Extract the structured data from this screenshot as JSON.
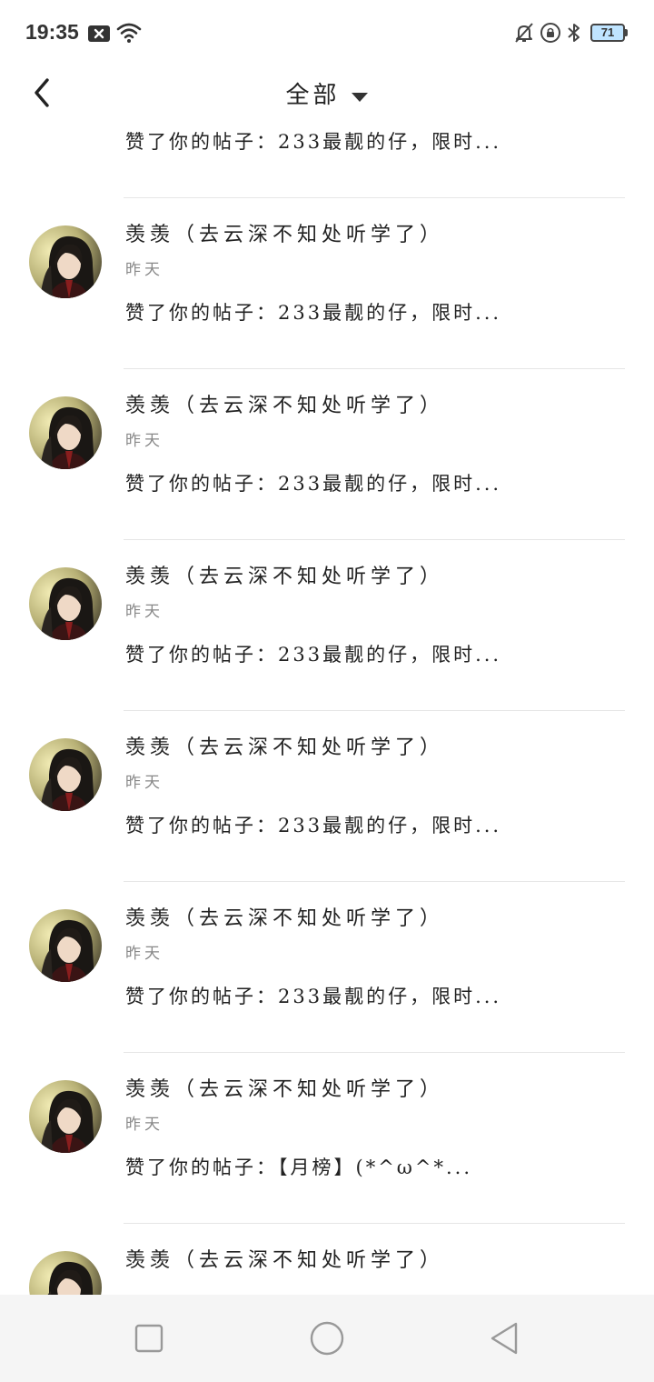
{
  "status_bar": {
    "time": "19:35",
    "battery": "71",
    "icons": [
      "close-box-icon",
      "wifi-icon",
      "bell-off-icon",
      "lock-rotation-icon",
      "bluetooth-icon",
      "battery-icon"
    ]
  },
  "header": {
    "title": "全部",
    "back_icon": "chevron-left-icon",
    "dropdown_icon": "caret-down-icon"
  },
  "notifications": [
    {
      "name": "",
      "time": "",
      "content": "赞了你的帖子：233最靓的仔，限时..."
    },
    {
      "name": "羡羡（去云深不知处听学了）",
      "time": "昨天",
      "content": "赞了你的帖子：233最靓的仔，限时..."
    },
    {
      "name": "羡羡（去云深不知处听学了）",
      "time": "昨天",
      "content": "赞了你的帖子：233最靓的仔，限时..."
    },
    {
      "name": "羡羡（去云深不知处听学了）",
      "time": "昨天",
      "content": "赞了你的帖子：233最靓的仔，限时..."
    },
    {
      "name": "羡羡（去云深不知处听学了）",
      "time": "昨天",
      "content": "赞了你的帖子：233最靓的仔，限时..."
    },
    {
      "name": "羡羡（去云深不知处听学了）",
      "time": "昨天",
      "content": "赞了你的帖子：233最靓的仔，限时..."
    },
    {
      "name": "羡羡（去云深不知处听学了）",
      "time": "昨天",
      "content": "赞了你的帖子：【月榜】(*^ω^*..."
    },
    {
      "name": "羡羡（去云深不知处听学了）",
      "time": "",
      "content": ""
    }
  ],
  "nav_bar": {
    "icons": [
      "recent-apps-icon",
      "home-icon",
      "back-triangle-icon"
    ]
  }
}
